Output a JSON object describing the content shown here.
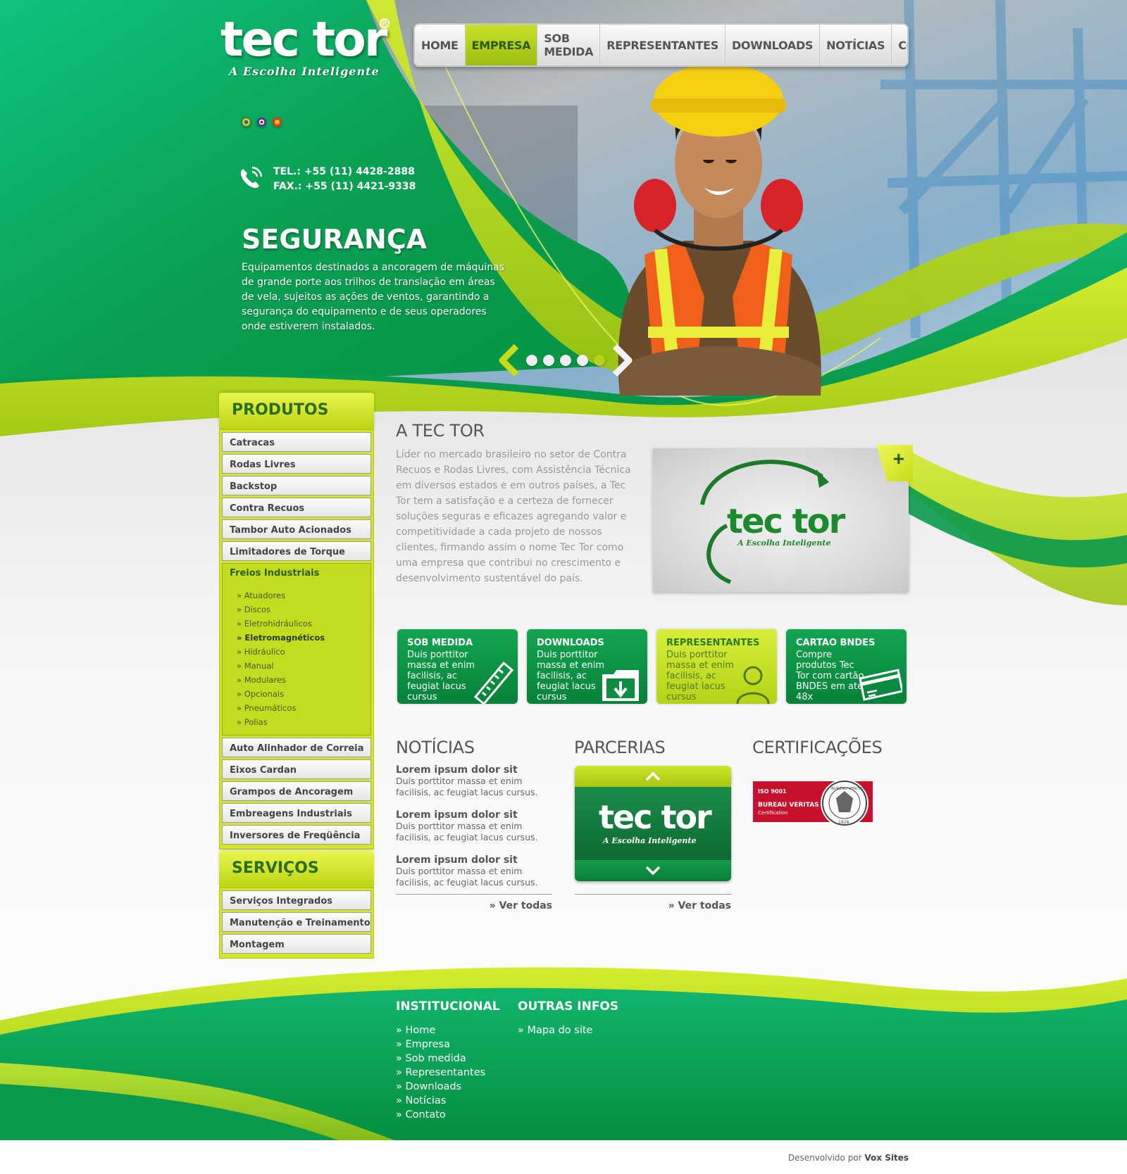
{
  "brand": {
    "logo_text": "tec tor",
    "logo_reg": "R",
    "tagline": "A Escolha Inteligente",
    "color_green": "#0a9a4e",
    "color_lime": "#c4dc1f"
  },
  "nav": {
    "items": [
      "HOME",
      "EMPRESA",
      "SOB MEDIDA",
      "REPRESENTANTES",
      "DOWNLOADS",
      "NOTÍCIAS",
      "CONTATO"
    ],
    "active": "EMPRESA"
  },
  "languages": [
    "flag-brazil-icon",
    "flag-english-icon",
    "flag-spanish-icon"
  ],
  "contact": {
    "tel": "TEL.: +55 (11) 4428-2888",
    "fax": "FAX.: +55 (11) 4421-9338"
  },
  "hero": {
    "title": "SEGURANÇA",
    "description": "Equipamentos destinados a ancoragem de máquinas de grande porte aos trilhos de translação em áreas de vela, sujeitos as ações de ventos, garantindo a segurança do equipamento e de seus operadores onde estiverem instalados.",
    "slides": 5,
    "active_slide": 5
  },
  "sidebar": {
    "produtos_title": "PRODUTOS",
    "produtos": [
      {
        "label": "Catracas"
      },
      {
        "label": "Rodas Livres"
      },
      {
        "label": "Backstop"
      },
      {
        "label": "Contra Recuos"
      },
      {
        "label": "Tambor Auto Acionados"
      },
      {
        "label": "Limitadores de Torque"
      },
      {
        "label": "Freios Industriais",
        "open": true,
        "subitems": [
          {
            "label": "» Atuadores"
          },
          {
            "label": "» Discos"
          },
          {
            "label": "» Eletrohidráulicos"
          },
          {
            "label": "» Eletromagnéticos",
            "strong": true
          },
          {
            "label": "» Hidráulico"
          },
          {
            "label": "» Manual"
          },
          {
            "label": "» Modulares"
          },
          {
            "label": "» Opcionais"
          },
          {
            "label": "» Pneumáticos"
          },
          {
            "label": "» Polias"
          }
        ]
      },
      {
        "label": "Auto Alinhador de Correia"
      },
      {
        "label": "Eixos Cardan"
      },
      {
        "label": "Grampos de Ancoragem"
      },
      {
        "label": "Embreagens Industriais"
      },
      {
        "label": "Inversores de Freqüência"
      }
    ],
    "servicos_title": "SERVIÇOS",
    "servicos": [
      {
        "label": "Serviços Integrados"
      },
      {
        "label": "Manutenção e Treinamento"
      },
      {
        "label": "Montagem"
      }
    ]
  },
  "about": {
    "title": "A TEC TOR",
    "text": "Líder no mercado brasileiro no setor de Contra Recuos e Rodas Livres, com Assistência Técnica em diversos estados e em outros países, a Tec Tor tem a satisfação e a certeza de fornecer soluções seguras e eficazes agregando valor e competitividade a cada projeto de nossos clientes, firmando assim o nome Tec Tor como uma empresa que contribui no crescimento e desenvolvimento sustentável do país.",
    "plus": "+"
  },
  "boxes": [
    {
      "title": "SOB MEDIDA",
      "desc": "Duis porttitor massa et enim facilisis, ac feugiat lacus cursus",
      "style": "g",
      "icon": "ruler-icon"
    },
    {
      "title": "DOWNLOADS",
      "desc": "Duis porttitor massa et enim facilisis, ac feugiat lacus cursus",
      "style": "g",
      "icon": "folder-download-icon"
    },
    {
      "title": "REPRESENTANTES",
      "desc": "Duis porttitor massa et enim facilisis, ac feugiat lacus cursus",
      "style": "y",
      "icon": "person-icon"
    },
    {
      "title": "CARTAO BNDES",
      "desc": "Compre produtos Tec Tor com cartão BNDES em até 48x",
      "style": "g",
      "icon": "credit-card-icon"
    }
  ],
  "news": {
    "title": "NOTÍCIAS",
    "items": [
      {
        "title": "Lorem ipsum dolor sit",
        "desc": "Duis porttitor massa et enim facilisis, ac feugiat lacus cursus."
      },
      {
        "title": "Lorem ipsum dolor sit",
        "desc": "Duis porttitor massa et enim facilisis, ac feugiat lacus cursus."
      },
      {
        "title": "Lorem ipsum dolor sit",
        "desc": "Duis porttitor massa et enim facilisis, ac feugiat lacus cursus."
      }
    ],
    "more": "» Ver todas"
  },
  "partners": {
    "title": "PARCERIAS",
    "more": "» Ver todas"
  },
  "certifications": {
    "title": "CERTIFICAÇÕES",
    "iso": "ISO 9001",
    "bv": "BUREAU VERITAS",
    "bv_sub": "Certification",
    "seal_ring": "BUREAU VERITAS",
    "seal_year": "1828"
  },
  "footer": {
    "col1_title": "INSTITUCIONAL",
    "col1_links": [
      "» Home",
      "» Empresa",
      "» Sob medida",
      "» Representantes",
      "» Downloads",
      "» Notícias",
      "» Contato"
    ],
    "col2_title": "OUTRAS INFOS",
    "col2_links": [
      "» Mapa do site"
    ],
    "credit_prefix": "Desenvolvido por",
    "credit_name": "Vox Sites"
  }
}
